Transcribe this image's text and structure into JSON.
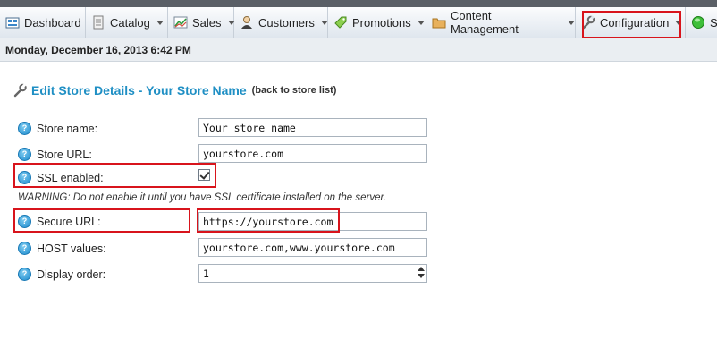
{
  "nav": {
    "items": [
      {
        "label": "Dashboard",
        "icon": "dashboard-icon"
      },
      {
        "label": "Catalog",
        "icon": "catalog-icon"
      },
      {
        "label": "Sales",
        "icon": "sales-chart-icon"
      },
      {
        "label": "Customers",
        "icon": "customers-icon"
      },
      {
        "label": "Promotions",
        "icon": "promotions-tag-icon"
      },
      {
        "label": "Content Management",
        "icon": "folder-icon"
      },
      {
        "label": "Configuration",
        "icon": "wrench-icon"
      },
      {
        "label": "Sy",
        "icon": "system-status-icon"
      }
    ]
  },
  "datebar": {
    "text": "Monday, December 16, 2013 6:42 PM"
  },
  "page": {
    "title": "Edit Store Details - Your Store Name",
    "back_link": "(back to store list)"
  },
  "form": {
    "store_name": {
      "label": "Store name:",
      "value": "Your store name"
    },
    "store_url": {
      "label": "Store URL:",
      "value": "yourstore.com"
    },
    "ssl_enabled": {
      "label": "SSL enabled:",
      "checked": true
    },
    "warning": "WARNING: Do not enable it until you have SSL certificate installed on the server.",
    "secure_url": {
      "label": "Secure URL:",
      "value": "https://yourstore.com"
    },
    "host_values": {
      "label": "HOST values:",
      "value": "yourstore.com,www.yourstore.com"
    },
    "display_order": {
      "label": "Display order:",
      "value": "1"
    }
  },
  "colors": {
    "accent": "#1f8fc4",
    "highlight": "#d8141c",
    "help_icon": "#1d8bcd"
  }
}
